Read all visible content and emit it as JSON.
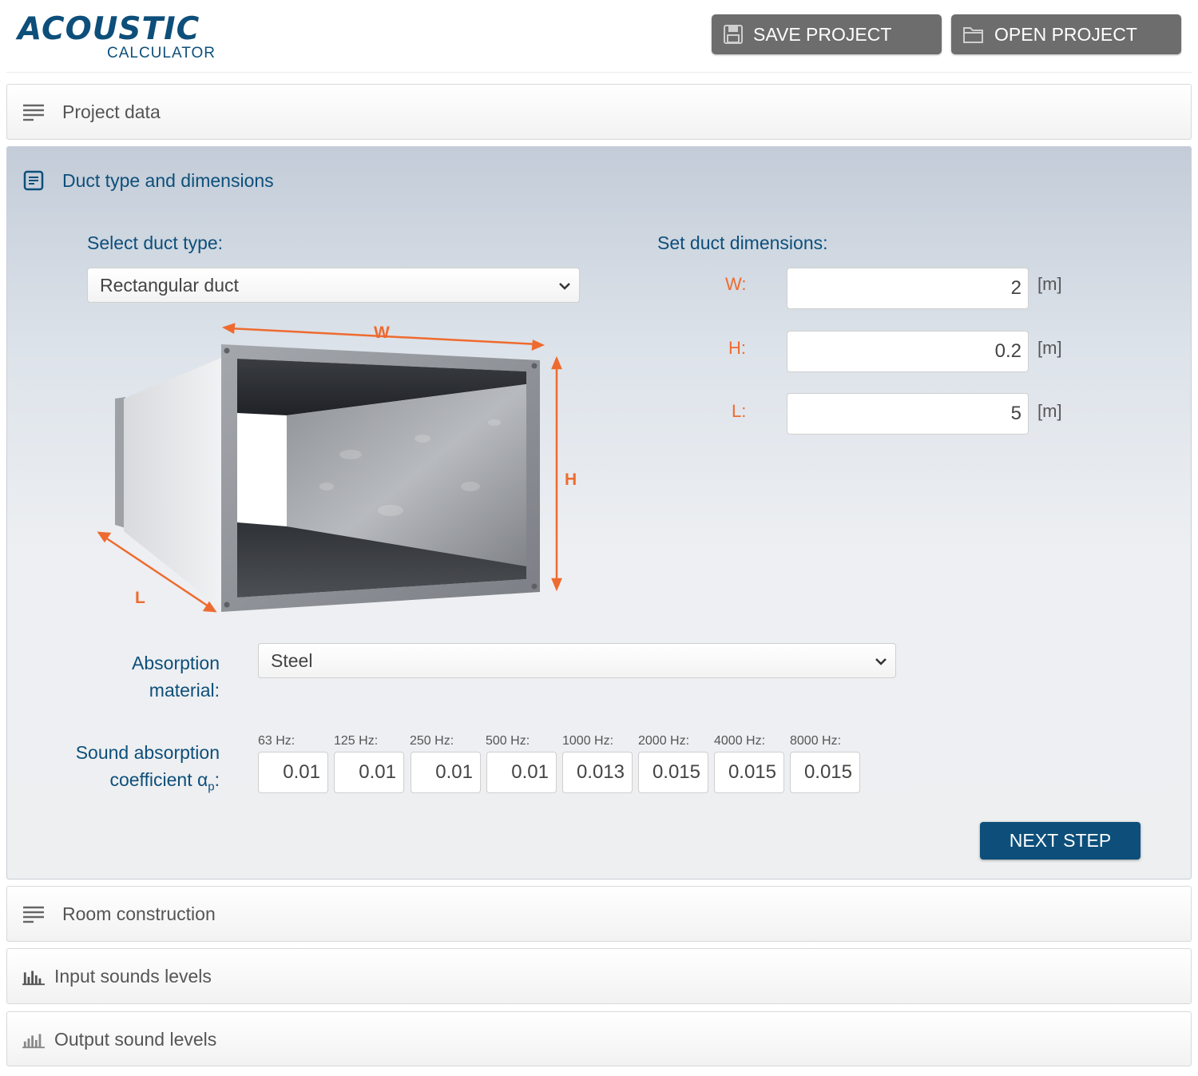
{
  "header": {
    "logo_main": "ACOUSTIC",
    "logo_sub": "CALCULATOR",
    "save_label": "SAVE PROJECT",
    "open_label": "OPEN PROJECT"
  },
  "panels": {
    "project_data": "Project data",
    "duct": "Duct type and dimensions",
    "room": "Room construction",
    "input": "Input sounds levels",
    "output": "Output sound levels"
  },
  "duct": {
    "select_type_label": "Select duct type:",
    "duct_type": "Rectangular duct",
    "dimensions_label": "Set duct dimensions:",
    "dimensions": [
      {
        "label": "W:",
        "value": "2",
        "unit": "[m]"
      },
      {
        "label": "H:",
        "value": "0.2",
        "unit": "[m]"
      },
      {
        "label": "L:",
        "value": "5",
        "unit": "[m]"
      }
    ],
    "diagram_labels": {
      "w": "W",
      "h": "H",
      "l": "L"
    },
    "absorption_label_1": "Absorption",
    "absorption_label_2": "material:",
    "absorption_material": "Steel",
    "coef_label_1": "Sound absorption",
    "coef_label_2": "coefficient α",
    "coef_label_sub": "p",
    "coef_label_colon": ":",
    "frequencies": [
      {
        "label": "63 Hz:",
        "value": "0.01"
      },
      {
        "label": "125 Hz:",
        "value": "0.01"
      },
      {
        "label": "250 Hz:",
        "value": "0.01"
      },
      {
        "label": "500 Hz:",
        "value": "0.01"
      },
      {
        "label": "1000 Hz:",
        "value": "0.013"
      },
      {
        "label": "2000 Hz:",
        "value": "0.015"
      },
      {
        "label": "4000 Hz:",
        "value": "0.015"
      },
      {
        "label": "8000 Hz:",
        "value": "0.015"
      }
    ],
    "next_label": "NEXT STEP"
  },
  "colors": {
    "brand_blue": "#0d4f7a",
    "accent_orange": "#ee6b2f",
    "header_button": "#6d6d6d"
  },
  "icons": {
    "save": "floppy-disk-icon",
    "open": "folder-icon",
    "list": "list-icon",
    "document": "document-icon",
    "bar_chart": "bar-chart-icon"
  }
}
